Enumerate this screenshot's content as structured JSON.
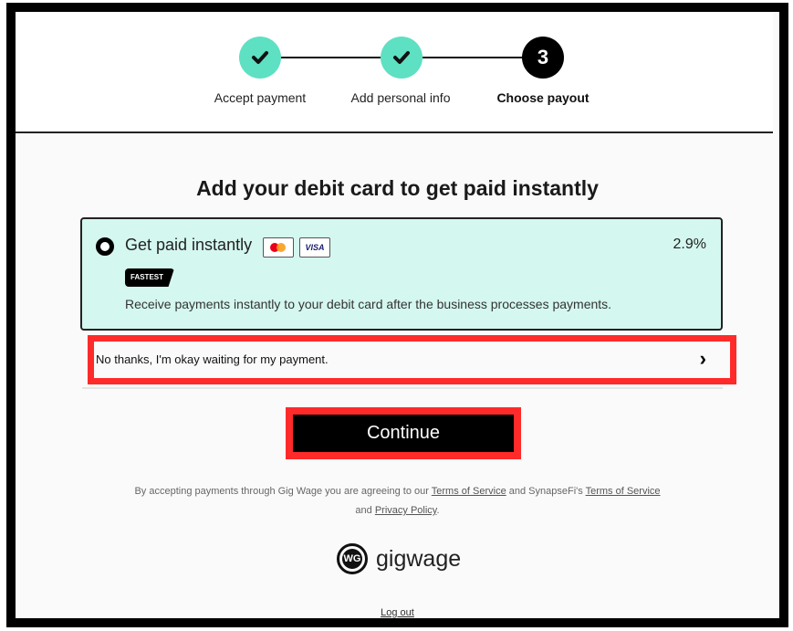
{
  "stepper": {
    "steps": [
      {
        "label": "Accept payment",
        "state": "complete",
        "icon": "check-icon"
      },
      {
        "label": "Add personal info",
        "state": "complete",
        "icon": "check-icon"
      },
      {
        "label": "Choose payout",
        "state": "active",
        "number": "3"
      }
    ]
  },
  "page_title": "Add your debit card to get paid instantly",
  "instant_option": {
    "title": "Get paid instantly",
    "card_logos": [
      "mastercard-icon",
      "visa-icon"
    ],
    "visa_label": "VISA",
    "fee": "2.9%",
    "badge": "FASTEST",
    "description": "Receive payments instantly to your debit card after the business processes payments.",
    "selected": false
  },
  "decline_option": {
    "label": "No thanks, I'm okay waiting for my payment.",
    "icon": "chevron-right-icon"
  },
  "continue_button": "Continue",
  "legal": {
    "prefix": "By accepting payments through Gig Wage you are agreeing to our",
    "tos_link": "Terms of Service",
    "middle": "and SynapseFi's",
    "tos_link_2": "Terms of Service",
    "and": "and",
    "privacy_link": "Privacy Policy",
    "suffix": "."
  },
  "brand": {
    "logo_letters": "WG",
    "name": "gigwage"
  },
  "logout_link": "Log out",
  "colors": {
    "step_complete": "#5ee0c2",
    "step_active": "#000000",
    "option_bg": "#d4f7ef",
    "highlight": "#ff2a2a"
  }
}
